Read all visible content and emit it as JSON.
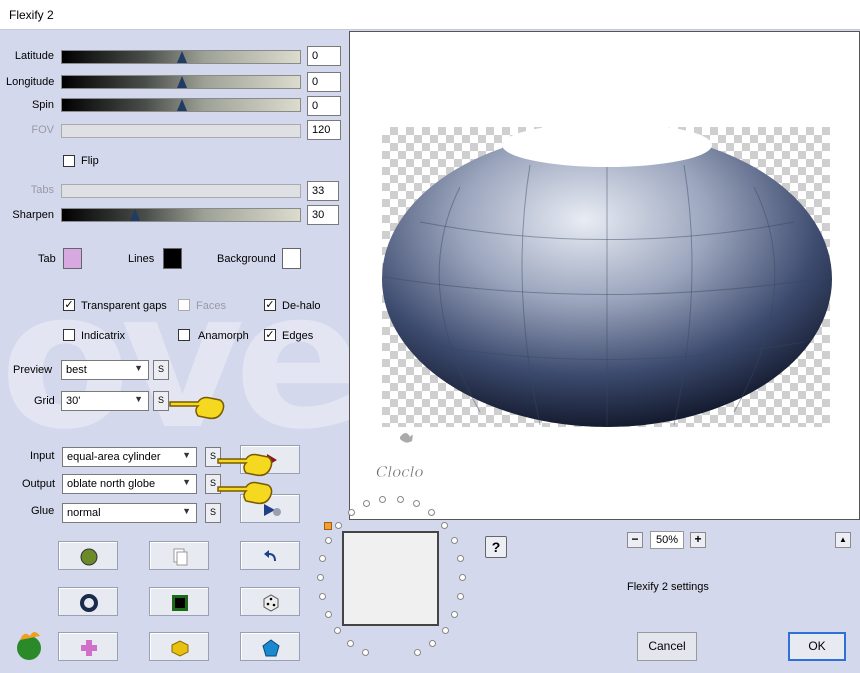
{
  "window": {
    "title": "Flexify 2"
  },
  "sliders": [
    {
      "label": "Latitude",
      "value": "0",
      "level": 0.5,
      "enabled": true
    },
    {
      "label": "Longitude",
      "value": "0",
      "level": 0.5,
      "enabled": true
    },
    {
      "label": "Spin",
      "value": "0",
      "level": 0.5,
      "enabled": true
    },
    {
      "label": "FOV",
      "value": "120",
      "level": null,
      "enabled": false
    },
    {
      "label": "Tabs",
      "value": "33",
      "level": null,
      "enabled": false
    },
    {
      "label": "Sharpen",
      "value": "30",
      "level": 0.3,
      "enabled": true
    }
  ],
  "flip": {
    "label": "Flip",
    "checked": false
  },
  "colors": {
    "tab_label": "Tab",
    "tab_color": "#d8a8e0",
    "lines_label": "Lines",
    "lines_color": "#000000",
    "background_label": "Background",
    "background_color": "#ffffff"
  },
  "options": {
    "transparent_gaps": {
      "label": "Transparent gaps",
      "checked": true,
      "mark": "✓"
    },
    "faces": {
      "label": "Faces",
      "checked": false
    },
    "de_halo": {
      "label": "De-halo",
      "checked": true,
      "mark": "✓"
    },
    "indicatrix": {
      "label": "Indicatrix",
      "checked": false
    },
    "anamorph": {
      "label": "Anamorph",
      "checked": false
    },
    "edges": {
      "label": "Edges",
      "checked": true,
      "mark": "✓"
    }
  },
  "dropdowns": {
    "preview": {
      "label": "Preview",
      "value": "best"
    },
    "grid": {
      "label": "Grid",
      "value": "30'"
    },
    "input": {
      "label": "Input",
      "value": "equal-area cylinder"
    },
    "output": {
      "label": "Output",
      "value": "oblate north globe"
    },
    "glue": {
      "label": "Glue",
      "value": "normal"
    }
  },
  "small_button_label": "S",
  "arrow_glyph": "▼",
  "zoom": {
    "minus": "−",
    "value": "50%",
    "plus": "+"
  },
  "up_glyph": "▲",
  "help_glyph": "?",
  "settings_text": "Flexify 2 settings",
  "buttons": {
    "cancel": "Cancel",
    "ok": "OK"
  },
  "watermark_text": "overs",
  "signature_text": "Cloclo"
}
